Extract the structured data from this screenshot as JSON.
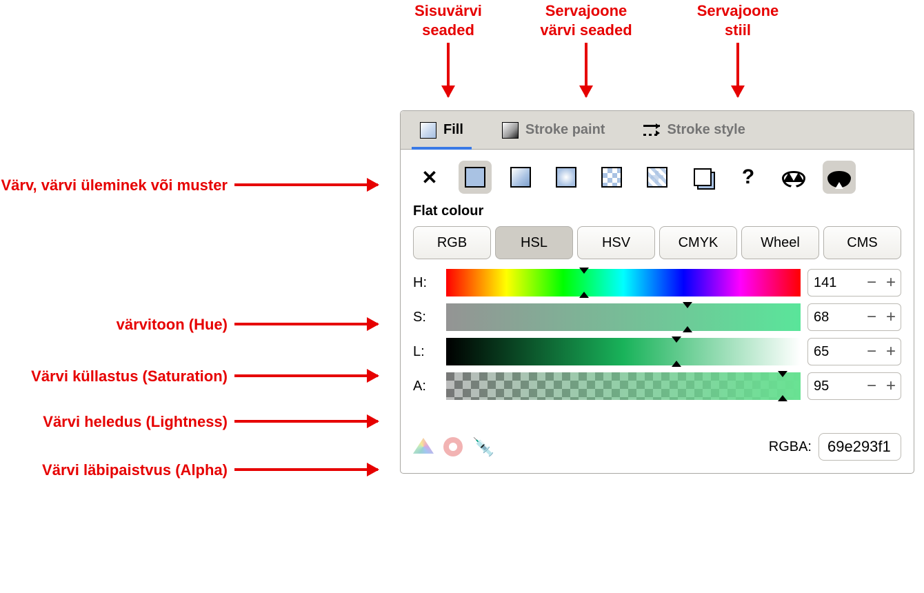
{
  "annotations": {
    "top_fill": "Sisuvärvi\nseaded",
    "top_stroke_paint": "Servajoone\nvärvi seaded",
    "top_stroke_style": "Servajoone\nstiil",
    "row_paint_types": "Värv, värvi üleminek või muster",
    "row_hue": "värvitoon (Hue)",
    "row_sat": "Värvi küllastus (Saturation)",
    "row_light": "Värvi heledus (Lightness)",
    "row_alpha": "Värvi läbipaistvus (Alpha)"
  },
  "tabs": {
    "fill": "Fill",
    "stroke_paint": "Stroke paint",
    "stroke_style": "Stroke style"
  },
  "section_label": "Flat colour",
  "models": [
    "RGB",
    "HSL",
    "HSV",
    "CMYK",
    "Wheel",
    "CMS"
  ],
  "active_model_index": 1,
  "sliders": {
    "h": {
      "label": "H:",
      "value": "141",
      "marker_pct": 39
    },
    "s": {
      "label": "S:",
      "value": "68",
      "marker_pct": 68
    },
    "l": {
      "label": "L:",
      "value": "65",
      "marker_pct": 65
    },
    "a": {
      "label": "A:",
      "value": "95",
      "marker_pct": 95
    }
  },
  "rgba": {
    "label": "RGBA:",
    "value": "69e293f1"
  }
}
